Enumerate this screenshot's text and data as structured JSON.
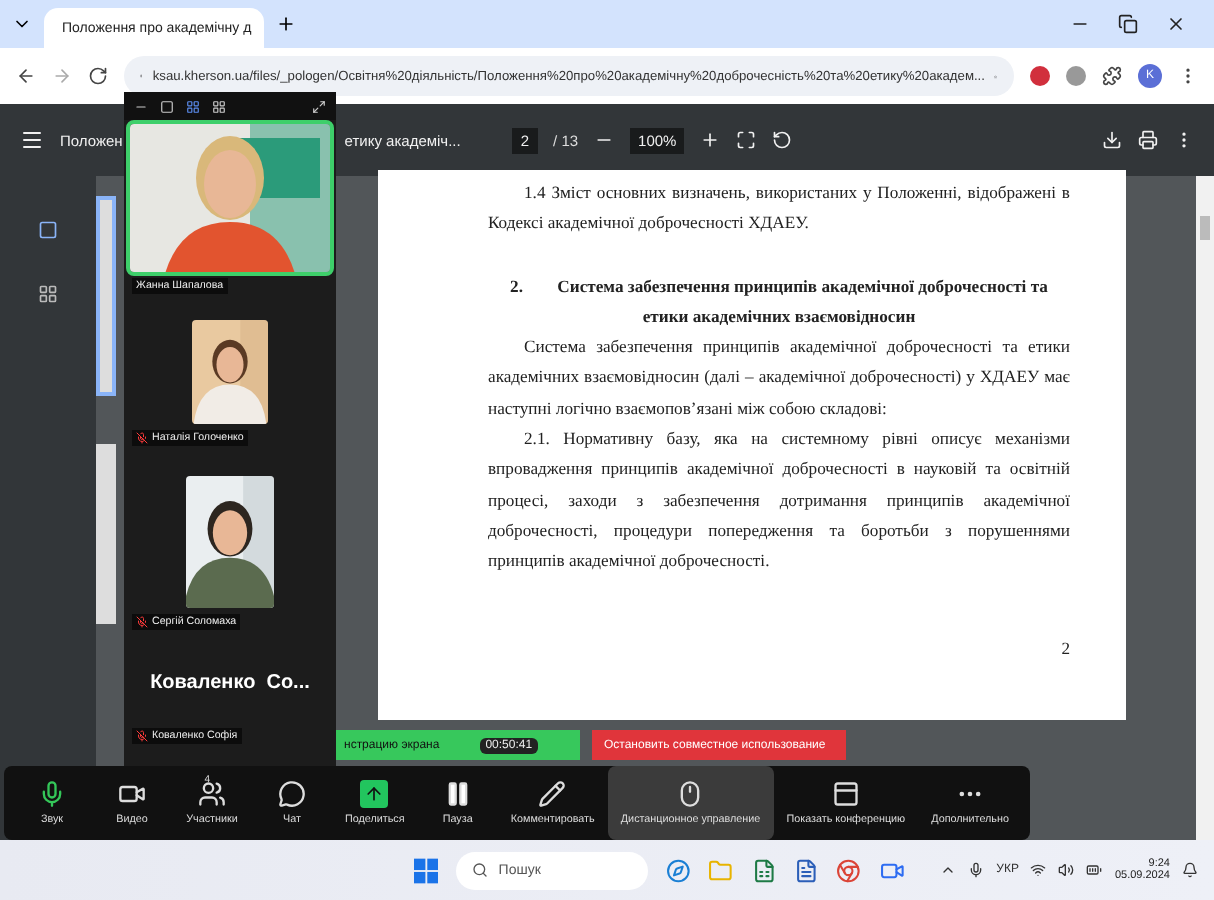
{
  "browser": {
    "tab": {
      "title": "Положення про академічну д",
      "selected": true
    },
    "url": "ksau.kherson.ua/files/_pologen/Освітня%20діяльність/Положення%20про%20академічну%20доброчесність%20та%20етику%20академ...",
    "profile_initial": "K"
  },
  "pdf_toolbar": {
    "title_start": "Положен",
    "title_end": "етику академіч...",
    "page": "2",
    "page_count": "/ 13",
    "zoom": "100%"
  },
  "document": {
    "blocks": [
      {
        "kind": "para",
        "text": "1.4  Зміст основних визначень, використаних у Положенні, відображені в Кодексі академічної доброчесності ХДАЕУ."
      },
      {
        "kind": "heading",
        "number": "2.",
        "text": "Система забезпечення принципів академічної доброчесності та етики академічних взаємовідносин"
      },
      {
        "kind": "para",
        "text": "Система забезпечення принципів академічної доброчесності та етики академічних взаємовідносин (далі – академічної доброчесності) у ХДАЕУ має наступні логічно взаємопов’язані між собою складові:"
      },
      {
        "kind": "para",
        "text": "2.1.  Нормативну базу, яка на системному рівні описує механізми впровадження принципів академічної доброчесності в науковій та освітній процесі, заходи з забезпечення дотримання принципів академічної доброчесності, процедури попередження та боротьби з порушеннями принципів академічної доброчесності."
      },
      {
        "kind": "page_number",
        "text": "2"
      }
    ]
  },
  "zoom_panel": {
    "participants": [
      {
        "kind": "video",
        "name": "Жанна Шапалова",
        "muted": false,
        "speaking": true
      },
      {
        "kind": "portrait",
        "name": "Наталія Голоченко",
        "muted": true,
        "speaking": false
      },
      {
        "kind": "portrait_tall",
        "name": "Сергій Соломаха",
        "muted": true,
        "speaking": false
      },
      {
        "kind": "avatar",
        "display_name": "Коваленко  Со...",
        "name": "Коваленко Софія",
        "muted": true,
        "speaking": false
      }
    ]
  },
  "share_bar": {
    "status": "нстрацию экрана",
    "timer": "00:50:41",
    "stop": "Остановить совместное использование"
  },
  "meeting_toolbar": [
    {
      "label": "Звук",
      "selected": false
    },
    {
      "label": "Видео",
      "selected": false
    },
    {
      "label": "Участники",
      "count": "4",
      "selected": false
    },
    {
      "label": "Чат",
      "selected": false
    },
    {
      "label": "Поделиться",
      "selected": false
    },
    {
      "label": "Пауза",
      "selected": false
    },
    {
      "label": "Комментировать",
      "selected": false
    },
    {
      "label": "Дистанционное управление",
      "selected": true
    },
    {
      "label": "Показать конференцию",
      "selected": false
    },
    {
      "label": "Дополнительно",
      "selected": false
    }
  ],
  "taskbar": {
    "search": "Пошук",
    "language": "УКР",
    "time": "9:24",
    "date": "05.09.2024"
  }
}
